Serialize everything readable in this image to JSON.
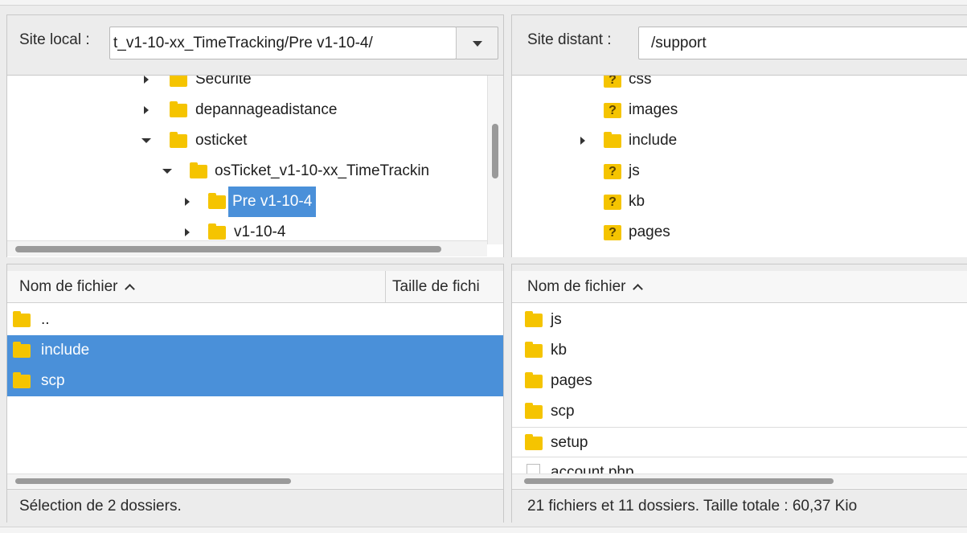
{
  "local": {
    "site_label": "Site local :",
    "path_value": "t_v1-10-xx_TimeTracking/Pre v1-10-4/",
    "tree": [
      {
        "label": "Securite",
        "arrow": "right"
      },
      {
        "label": "depannageadistance",
        "arrow": "right"
      },
      {
        "label": "osticket",
        "arrow": "down"
      },
      {
        "label": "osTicket_v1-10-xx_TimeTrackin",
        "arrow": "down"
      },
      {
        "label": "Pre v1-10-4",
        "arrow": "right",
        "selected": true
      },
      {
        "label": "v1-10-4",
        "arrow": "right"
      }
    ],
    "columns": [
      "Nom de fichier",
      "Taille de fichi"
    ],
    "files": [
      {
        "name": "..",
        "selected": false
      },
      {
        "name": "include",
        "selected": true
      },
      {
        "name": "scp",
        "selected": true
      }
    ],
    "status": "Sélection de 2 dossiers."
  },
  "remote": {
    "site_label": "Site distant :",
    "path_value": "/support",
    "tree": [
      {
        "label": "css",
        "icon": "unknown-folder",
        "arrow": "none"
      },
      {
        "label": "images",
        "icon": "unknown-folder",
        "arrow": "none"
      },
      {
        "label": "include",
        "icon": "folder",
        "arrow": "right"
      },
      {
        "label": "js",
        "icon": "unknown-folder",
        "arrow": "none"
      },
      {
        "label": "kb",
        "icon": "unknown-folder",
        "arrow": "none"
      },
      {
        "label": "pages",
        "icon": "unknown-folder",
        "arrow": "none"
      }
    ],
    "columns": [
      "Nom de fichier"
    ],
    "files": [
      {
        "name": "js",
        "type": "folder"
      },
      {
        "name": "kb",
        "type": "folder"
      },
      {
        "name": "pages",
        "type": "folder"
      },
      {
        "name": "scp",
        "type": "folder"
      },
      {
        "name": "setup",
        "type": "folder"
      },
      {
        "name": "account.php",
        "type": "file"
      }
    ],
    "status": "21 fichiers et 11 dossiers. Taille totale : 60,37 Kio"
  },
  "colors": {
    "selection": "#4a90d9",
    "folder": "#f5c400"
  }
}
